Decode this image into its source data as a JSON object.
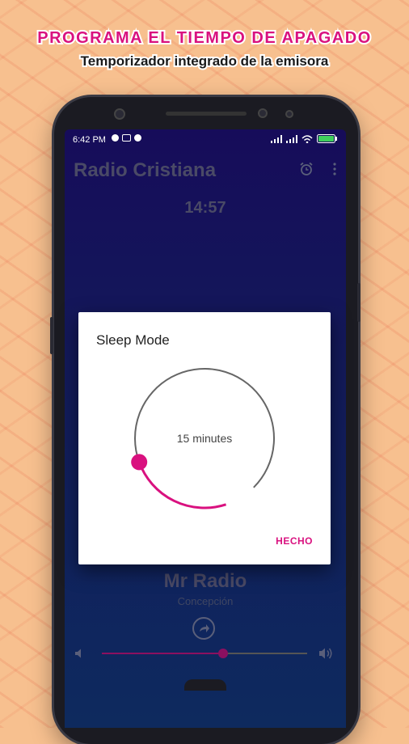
{
  "promo": {
    "headline": "PROGRAMA EL TIEMPO DE APAGADO",
    "subheadline": "Temporizador integrado de la emisora"
  },
  "statusbar": {
    "time": "6:42 PM",
    "icons": [
      "f-icon",
      "cast-icon",
      "f-icon",
      "signal-icon",
      "signal-icon",
      "wifi-icon",
      "battery-icon"
    ]
  },
  "app": {
    "title": "Radio Cristiana",
    "countdown": "14:57",
    "actions": [
      "alarm-clock-icon",
      "more-vert-icon"
    ]
  },
  "dialog": {
    "title": "Sleep Mode",
    "value_label": "15 minutes",
    "value_fraction": 0.125,
    "done_label": "HECHO",
    "accent": "#d9117f"
  },
  "player": {
    "station_name": "Mr Radio",
    "station_city": "Concepción",
    "volume_fraction": 0.59,
    "accent": "#8b1060"
  }
}
